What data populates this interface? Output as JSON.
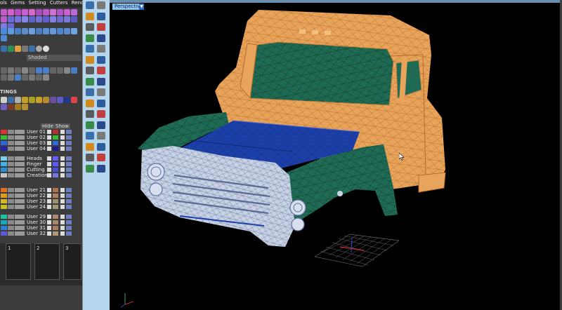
{
  "menu": {
    "items": [
      "ols",
      "Gems",
      "Setting",
      "Cutters",
      "Render"
    ]
  },
  "display_mode": "Shaded",
  "settings_title": "TINGS",
  "layer_panel": {
    "hide_label": "Hide",
    "show_label": "Show",
    "groups": [
      {
        "rows": [
          {
            "label": "User 01",
            "color": "#e23030",
            "color2": "#c02a2a"
          },
          {
            "label": "User 02",
            "color": "#2ec22e",
            "color2": "#2ec22e"
          },
          {
            "label": "User 03",
            "color": "#2f66e8",
            "color2": "#2f66e8"
          },
          {
            "label": "User 04",
            "color": "#2222aa",
            "color2": "#1c1c99"
          }
        ]
      },
      {
        "rows": [
          {
            "label": "Heads",
            "color": "#7ad0f0",
            "color2": "#6060ff"
          },
          {
            "label": "Finger",
            "color": "#3fb3e8",
            "color2": "#5a5aff"
          },
          {
            "label": "Cutting",
            "color": "#2b8fd8",
            "color2": "#4a4adc"
          },
          {
            "label": "Creation",
            "color": "#c8c8c8",
            "color2": "#7676e0"
          }
        ]
      },
      {
        "rows": [
          {
            "label": "User 21",
            "color": "#e07020",
            "color2": "#b07050"
          },
          {
            "label": "User 22",
            "color": "#e09a20",
            "color2": "#b08060"
          },
          {
            "label": "User 23",
            "color": "#d6b82a",
            "color2": "#a09070"
          },
          {
            "label": "User 24",
            "color": "#c8c020",
            "color2": "#a09878"
          }
        ]
      },
      {
        "rows": [
          {
            "label": "User 29",
            "color": "#20c0a0",
            "color2": "#b08870"
          },
          {
            "label": "User 30",
            "color": "#18a8b8",
            "color2": "#a88868"
          },
          {
            "label": "User 31",
            "color": "#2a7ed8",
            "color2": "#a88060"
          },
          {
            "label": "User 32",
            "color": "#5a5ad8",
            "color2": "#b09878"
          }
        ]
      }
    ]
  },
  "slots": [
    "1",
    "2",
    "3"
  ],
  "viewport": {
    "tab": "Perspective"
  },
  "colors": {
    "cab": "#e8a45a",
    "fender": "#1f6b55",
    "grille": "#c9d3e6",
    "bed": "#1d3fa8",
    "tool_column": "#b6d6ee"
  }
}
